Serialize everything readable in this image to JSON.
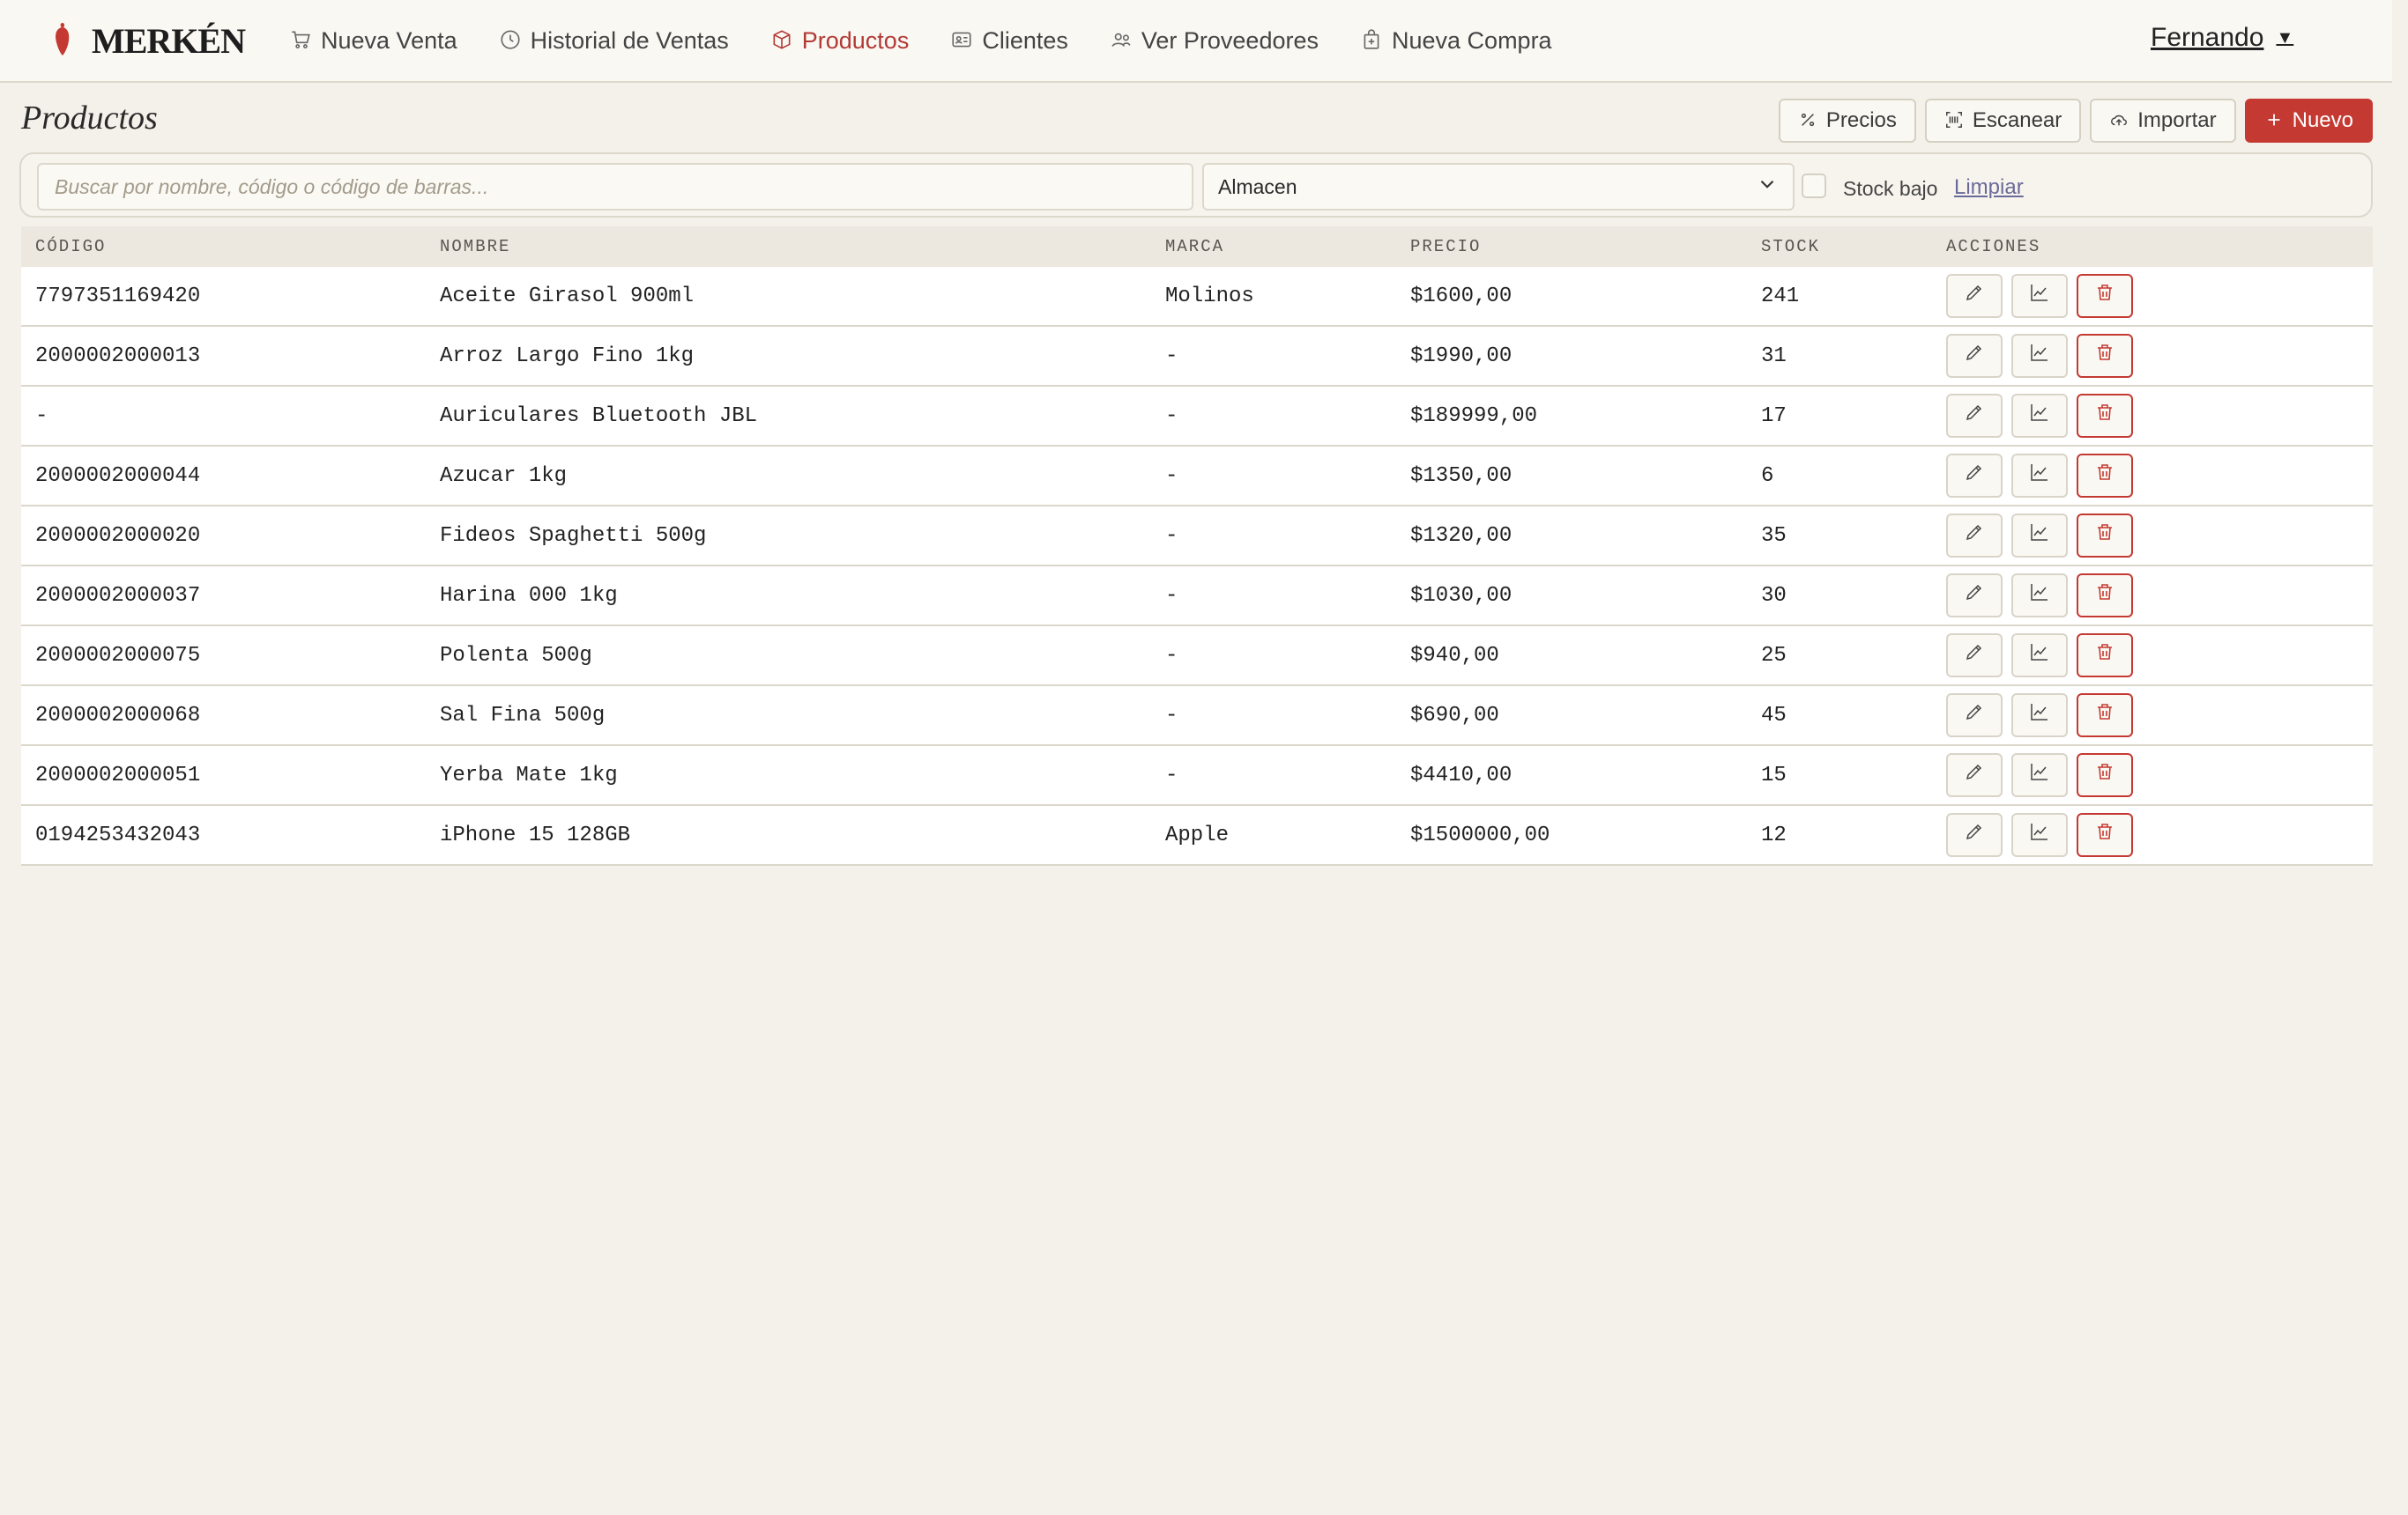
{
  "brand": {
    "name": "MERKÉN"
  },
  "nav": {
    "items": [
      {
        "label": "Nueva Venta",
        "icon": "cart-icon"
      },
      {
        "label": "Historial de Ventas",
        "icon": "clock-icon"
      },
      {
        "label": "Productos",
        "icon": "box-icon",
        "active": true
      },
      {
        "label": "Clientes",
        "icon": "id-card-icon"
      },
      {
        "label": "Ver Proveedores",
        "icon": "users-icon"
      },
      {
        "label": "Nueva Compra",
        "icon": "bag-plus-icon"
      }
    ],
    "user": "Fernando"
  },
  "page": {
    "title": "Productos"
  },
  "toolbar": {
    "prices": "Precios",
    "scan": "Escanear",
    "import": "Importar",
    "new": "Nuevo"
  },
  "filters": {
    "search_placeholder": "Buscar por nombre, código o código de barras...",
    "category": "Almacen",
    "low_stock_label": "Stock bajo",
    "clear": "Limpiar"
  },
  "table": {
    "headers": [
      "CÓDIGO",
      "NOMBRE",
      "MARCA",
      "PRECIO",
      "STOCK",
      "ACCIONES"
    ],
    "rows": [
      {
        "code": "7797351169420",
        "name": "Aceite Girasol 900ml",
        "brand": "Molinos",
        "price": "$1600,00",
        "stock": "241"
      },
      {
        "code": "2000002000013",
        "name": "Arroz Largo Fino 1kg",
        "brand": "-",
        "price": "$1990,00",
        "stock": "31"
      },
      {
        "code": "-",
        "name": "Auriculares Bluetooth JBL",
        "brand": "-",
        "price": "$189999,00",
        "stock": "17"
      },
      {
        "code": "2000002000044",
        "name": "Azucar 1kg",
        "brand": "-",
        "price": "$1350,00",
        "stock": "6"
      },
      {
        "code": "2000002000020",
        "name": "Fideos Spaghetti 500g",
        "brand": "-",
        "price": "$1320,00",
        "stock": "35"
      },
      {
        "code": "2000002000037",
        "name": "Harina 000 1kg",
        "brand": "-",
        "price": "$1030,00",
        "stock": "30"
      },
      {
        "code": "2000002000075",
        "name": "Polenta 500g",
        "brand": "-",
        "price": "$940,00",
        "stock": "25"
      },
      {
        "code": "2000002000068",
        "name": "Sal Fina 500g",
        "brand": "-",
        "price": "$690,00",
        "stock": "45"
      },
      {
        "code": "2000002000051",
        "name": "Yerba Mate 1kg",
        "brand": "-",
        "price": "$4410,00",
        "stock": "15"
      },
      {
        "code": "0194253432043",
        "name": "iPhone 15 128GB",
        "brand": "Apple",
        "price": "$1500000,00",
        "stock": "12"
      }
    ]
  },
  "colors": {
    "accent": "#b23a36",
    "primary_button": "#c43a33",
    "background": "#f4f1ea"
  }
}
